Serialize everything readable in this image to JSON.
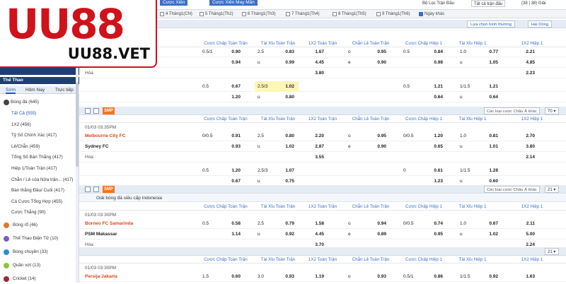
{
  "logo": {
    "big": "UU88",
    "small": "UU88.VET"
  },
  "top": {
    "tab1": "Cược Xiên",
    "tab2": "Cược Xiên May Mắn",
    "filter_label": "Bộ Lọc Trận Đấu",
    "filter_value": "Tất cả trận đấu",
    "count": "(38 | 38) Giải"
  },
  "dates": [
    {
      "label": "4 Tháng1(CN)",
      "checked": false
    },
    {
      "label": "5 Tháng1(Th2)",
      "checked": false
    },
    {
      "label": "6 Tháng1(Th3)",
      "checked": false
    },
    {
      "label": "7 Tháng1(Th4)",
      "checked": false
    },
    {
      "label": "8 Tháng1(Th5)",
      "checked": false
    },
    {
      "label": "9 Tháng1(Th6)",
      "checked": false
    },
    {
      "label": "Ngày khác",
      "checked": true
    }
  ],
  "sidebar": {
    "section": "Thể Thao",
    "tabs": [
      "Sớm",
      "Hôm Nay",
      "Trực tiếp"
    ],
    "football": {
      "label": "Bóng đá",
      "count": "(645)"
    },
    "sub_items": [
      {
        "label": "Tất Cả",
        "count": "(555)"
      },
      {
        "label": "1X2",
        "count": "(456)"
      },
      {
        "label": "Tỷ Số Chính Xác",
        "count": "(417)"
      },
      {
        "label": "Lẻ/Chẵn",
        "count": "(459)"
      },
      {
        "label": "Tổng Số Bàn Thắng",
        "count": "(417)"
      },
      {
        "label": "Hiệp 1/Toàn Trận",
        "count": "(417)"
      },
      {
        "label": "Chẵn / Lẻ của Nửa trận...",
        "count": "(417)"
      },
      {
        "label": "Bàn thắng Đầu/ Cuối",
        "count": "(417)"
      },
      {
        "label": "Cá Cược Tổng Hợp",
        "count": "(455)"
      },
      {
        "label": "Cược Thắng",
        "count": "(90)"
      }
    ],
    "sports": [
      {
        "label": "Bóng rổ",
        "count": "(46)",
        "color": "#e8742a"
      },
      {
        "label": "Thể Thao Điện Tử",
        "count": "(10)",
        "color": "#7b5ad1"
      },
      {
        "label": "Bóng chuyền",
        "count": "(33)",
        "color": "#2a8fd6"
      },
      {
        "label": "Quần vợt",
        "count": "(13)",
        "color": "#8cc63f"
      },
      {
        "label": "Cricket",
        "count": "(14)",
        "color": "#a0282d"
      }
    ]
  },
  "main": {
    "sort": "Lựa chọn bình thường",
    "odds_type": "Hai Dòng",
    "more_bets": "Các loại cược Châu Á khác",
    "smp": "SMP",
    "headers": [
      "Cược Chấp Toàn Trận",
      "Tài Xỉu Toàn Trận",
      "1X2 Toàn Trận",
      "Chẵn Lẻ Toàn Trận",
      "Cược Chấp Hiệp 1",
      "Tài Xỉu Hiệp 1",
      "1X2 Hiệp 1"
    ],
    "draw": "Hòa",
    "league_indonesia": "Giải bóng đá siêu cấp Indonesia",
    "dd": [
      "70",
      "21",
      "21"
    ],
    "m0": {
      "r1": [
        "0.5/1",
        "0.90",
        "2.5",
        "0.83",
        "1.67",
        "o",
        "0.95",
        "0.5",
        "0.84",
        "1.0",
        "0.77",
        "2.21"
      ],
      "r2": [
        "0.94",
        "u",
        "0.99",
        "4.45",
        "e",
        "0.90",
        "0.98",
        "u",
        "1.05",
        "4.85"
      ],
      "r3": [
        "3.80",
        "2.23"
      ],
      "a1": [
        "0.5",
        "0.67",
        "2.5/3",
        "1.02",
        "0.5",
        "1.21",
        "1/1.5",
        "1.21"
      ],
      "a2": [
        "1.20",
        "u",
        "0.80",
        "0.64",
        "u",
        "0.64"
      ]
    },
    "m1": {
      "time": "01/03 03:35PM",
      "home": "Melbourne City FC",
      "away": "Sydney FC",
      "r1": [
        "0/0.5",
        "0.91",
        "2.5",
        "0.80",
        "2.20",
        "o",
        "0.95",
        "0/0.5",
        "1.20",
        "1.0",
        "0.81",
        "2.70"
      ],
      "r2": [
        "0.93",
        "u",
        "1.02",
        "2.87",
        "e",
        "0.90",
        "0.65",
        "u",
        "1.01",
        "3.80"
      ],
      "r3": [
        "3.55",
        "2.14"
      ],
      "a1": [
        "0.5",
        "1.20",
        "2.5/3",
        "1.07",
        "0",
        "0.61",
        "1/1.5",
        "1.28"
      ],
      "a2": [
        "0.67",
        "u",
        "0.75",
        "1.23",
        "u",
        "0.60"
      ]
    },
    "m2": {
      "time": "01/03 03:30PM",
      "home": "Borneo FC Samarinda",
      "away": "PSM Makassar",
      "r1": [
        "0.5",
        "0.58",
        "2.5",
        "0.79",
        "1.58",
        "o",
        "0.94",
        "0/0.5",
        "0.74",
        "1.0",
        "0.67",
        "2.11"
      ],
      "r2": [
        "1.14",
        "u",
        "0.92",
        "4.45",
        "e",
        "0.89",
        "0.95",
        "u",
        "1.02",
        "5.00"
      ],
      "r3": [
        "3.70",
        "2.24"
      ]
    },
    "m3": {
      "time": "01/03 03:30PM",
      "home": "Persija Jakarta",
      "r1": [
        "1.5",
        "0.60",
        "3.0",
        "0.93",
        "1.19",
        "o",
        "0.93",
        "0.5/1",
        "0.86",
        "1/1.5",
        "0.92",
        "1.63"
      ]
    }
  }
}
